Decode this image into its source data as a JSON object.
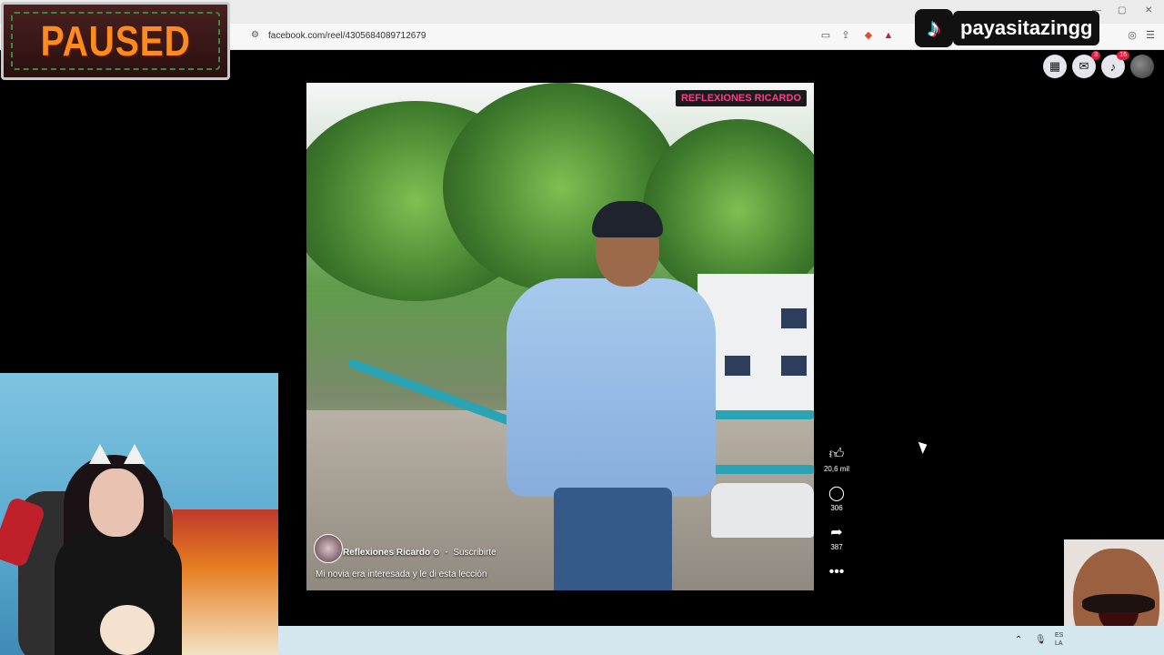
{
  "browser": {
    "url": "facebook.com/reel/4305684089712679",
    "icons": [
      "tune-icon",
      "screen-cast-icon",
      "share-icon",
      "brave-shield-icon",
      "brave-rewards-icon",
      "extension-shield-icon",
      "menu-icon"
    ]
  },
  "overlay": {
    "paused_label": "PAUSED",
    "tiktok_handle": "payasitazingg",
    "tiktok_icon": "tiktok-note-icon"
  },
  "facebook_nav": {
    "menu_icon": "grid-menu-icon",
    "messenger_badge": "3",
    "notifications_badge": "16"
  },
  "reel": {
    "watermark": "REFLEXIONES RICARDO",
    "author": "Reflexiones Ricardo",
    "verified_glyph": "⊙",
    "separator": "·",
    "follow": "Suscribirte",
    "caption": "Mi novia era interesada y le di esta lección"
  },
  "actions": {
    "likes": "20,6 mil",
    "comments": "306",
    "shares": "387"
  },
  "taskbar": {
    "lang_top": "ES",
    "lang_bottom": "LA"
  }
}
